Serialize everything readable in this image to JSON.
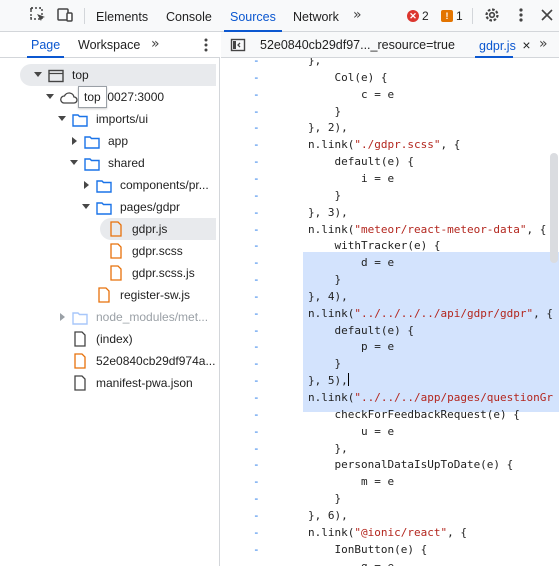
{
  "toolbar": {
    "tabs": [
      "Elements",
      "Console",
      "Sources",
      "Network"
    ],
    "active_tab": "Sources",
    "more_tabs": "»",
    "errors": "2",
    "warnings": "1"
  },
  "navigator": {
    "tabs": [
      "Page",
      "Workspace"
    ],
    "more": "»",
    "tree": [
      {
        "label": "top",
        "depth": 0,
        "kind": "frame",
        "arrow": "down"
      },
      {
        "label": "-lnx-0027:3000",
        "depth": 1,
        "kind": "cloud",
        "arrow": "down"
      },
      {
        "label": "imports/ui",
        "depth": 2,
        "kind": "folder",
        "arrow": "down"
      },
      {
        "label": "app",
        "depth": 3,
        "kind": "folder",
        "arrow": "right"
      },
      {
        "label": "shared",
        "depth": 3,
        "kind": "folder",
        "arrow": "down"
      },
      {
        "label": "components/pr...",
        "depth": 4,
        "kind": "folder",
        "arrow": "right"
      },
      {
        "label": "pages/gdpr",
        "depth": 4,
        "kind": "folder",
        "arrow": "down"
      },
      {
        "label": "gdpr.js",
        "depth": 5,
        "kind": "file-orange",
        "arrow": "none",
        "selected": true
      },
      {
        "label": "gdpr.scss",
        "depth": 5,
        "kind": "file-orange",
        "arrow": "none"
      },
      {
        "label": "gdpr.scss.js",
        "depth": 5,
        "kind": "file-orange",
        "arrow": "none"
      },
      {
        "label": "register-sw.js",
        "depth": 4,
        "kind": "file-orange",
        "arrow": "none"
      },
      {
        "label": "node_modules/met...",
        "depth": 2,
        "kind": "folder-dim",
        "arrow": "right-dim"
      },
      {
        "label": "(index)",
        "depth": 2,
        "kind": "file",
        "arrow": "none"
      },
      {
        "label": "52e0840cb29df974a...",
        "depth": 2,
        "kind": "file-orange",
        "arrow": "none"
      },
      {
        "label": "manifest-pwa.json",
        "depth": 2,
        "kind": "file",
        "arrow": "none"
      }
    ],
    "tooltip": "top"
  },
  "editor": {
    "tabs": [
      "52e0840cb29df97..._resource=true",
      "gdpr.js"
    ],
    "active_tab": "gdpr.js",
    "close_icon": "×",
    "more": "»",
    "code": [
      {
        "g": "-",
        "text": "},"
      },
      {
        "g": "-",
        "text": "    Col(e) {"
      },
      {
        "g": "-",
        "text": "        c = e"
      },
      {
        "g": "-",
        "text": "    }"
      },
      {
        "g": "-",
        "text": "}, 2),"
      },
      {
        "g": "-",
        "text": "n.link(",
        "str": "\"./gdpr.scss\"",
        "rest": ", {"
      },
      {
        "g": "-",
        "text": "    default(e) {"
      },
      {
        "g": "-",
        "text": "        i = e"
      },
      {
        "g": "-",
        "text": "    }"
      },
      {
        "g": "-",
        "text": "}, 3),"
      },
      {
        "g": "-",
        "text": "n.link(",
        "str": "\"meteor/react-meteor-data\"",
        "rest": ", {"
      },
      {
        "g": "-",
        "text": "    withTracker(e) {"
      },
      {
        "g": "-",
        "text": "        d = e"
      },
      {
        "g": "-",
        "text": "    }"
      },
      {
        "g": "-",
        "text": "}, 4),"
      },
      {
        "g": "-",
        "text": "n.link(",
        "str": "\"../../../../api/gdpr/gdpr\"",
        "rest": ", {"
      },
      {
        "g": "-",
        "text": "    default(e) {"
      },
      {
        "g": "-",
        "text": "        p = e"
      },
      {
        "g": "-",
        "text": "    }"
      },
      {
        "g": "-",
        "text": "}, 5),",
        "cursor": true
      },
      {
        "g": "-",
        "text": "n.link(",
        "str": "\"../../../app/pages/questionGr",
        "rest": ""
      },
      {
        "g": "-",
        "text": "    checkForFeedbackRequest(e) {"
      },
      {
        "g": "-",
        "text": "        u = e"
      },
      {
        "g": "-",
        "text": "    },"
      },
      {
        "g": "-",
        "text": "    personalDataIsUpToDate(e) {"
      },
      {
        "g": "-",
        "text": "        m = e"
      },
      {
        "g": "-",
        "text": "    }"
      },
      {
        "g": "-",
        "text": "}, 6),"
      },
      {
        "g": "-",
        "text": "n.link(",
        "str": "\"@ionic/react\"",
        "rest": ", {"
      },
      {
        "g": "-",
        "text": "    IonButton(e) {"
      },
      {
        "g": "-",
        "text": "        g = e"
      }
    ]
  }
}
